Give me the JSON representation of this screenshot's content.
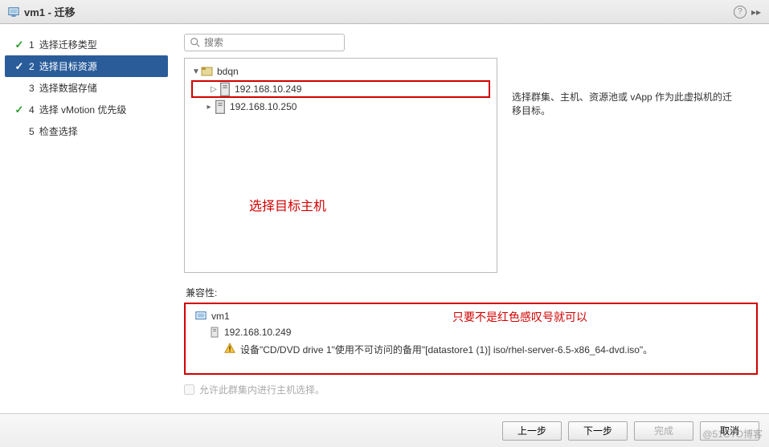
{
  "title": "vm1 - 迁移",
  "search_placeholder": "搜索",
  "steps": [
    {
      "num": "1",
      "label": "选择迁移类型",
      "state": "done"
    },
    {
      "num": "2",
      "label": "选择目标资源",
      "state": "active"
    },
    {
      "num": "3",
      "label": "选择数据存储",
      "state": ""
    },
    {
      "num": "4",
      "label": "选择 vMotion 优先级",
      "state": "done"
    },
    {
      "num": "5",
      "label": "检查选择",
      "state": ""
    }
  ],
  "tree": {
    "root": {
      "label": "bdqn"
    },
    "hosts": [
      {
        "label": "192.168.10.249",
        "selected": true
      },
      {
        "label": "192.168.10.250",
        "selected": false
      }
    ]
  },
  "hint_text": "选择群集、主机、资源池或 vApp 作为此虚拟机的迁移目标。",
  "annotation_tree": "选择目标主机",
  "compat_label": "兼容性:",
  "compat": {
    "vm": "vm1",
    "host": "192.168.10.249",
    "warning": "设备\"CD/DVD drive 1\"使用不可访问的备用\"[datastore1 (1)] iso/rhel-server-6.5-x86_64-dvd.iso\"。"
  },
  "annotation_compat": "只要不是红色感叹号就可以",
  "cluster_checkbox_label": "允许此群集内进行主机选择。",
  "buttons": {
    "back": "上一步",
    "next": "下一步",
    "finish": "完成",
    "cancel": "取消"
  },
  "watermark": "@51CTO博客"
}
